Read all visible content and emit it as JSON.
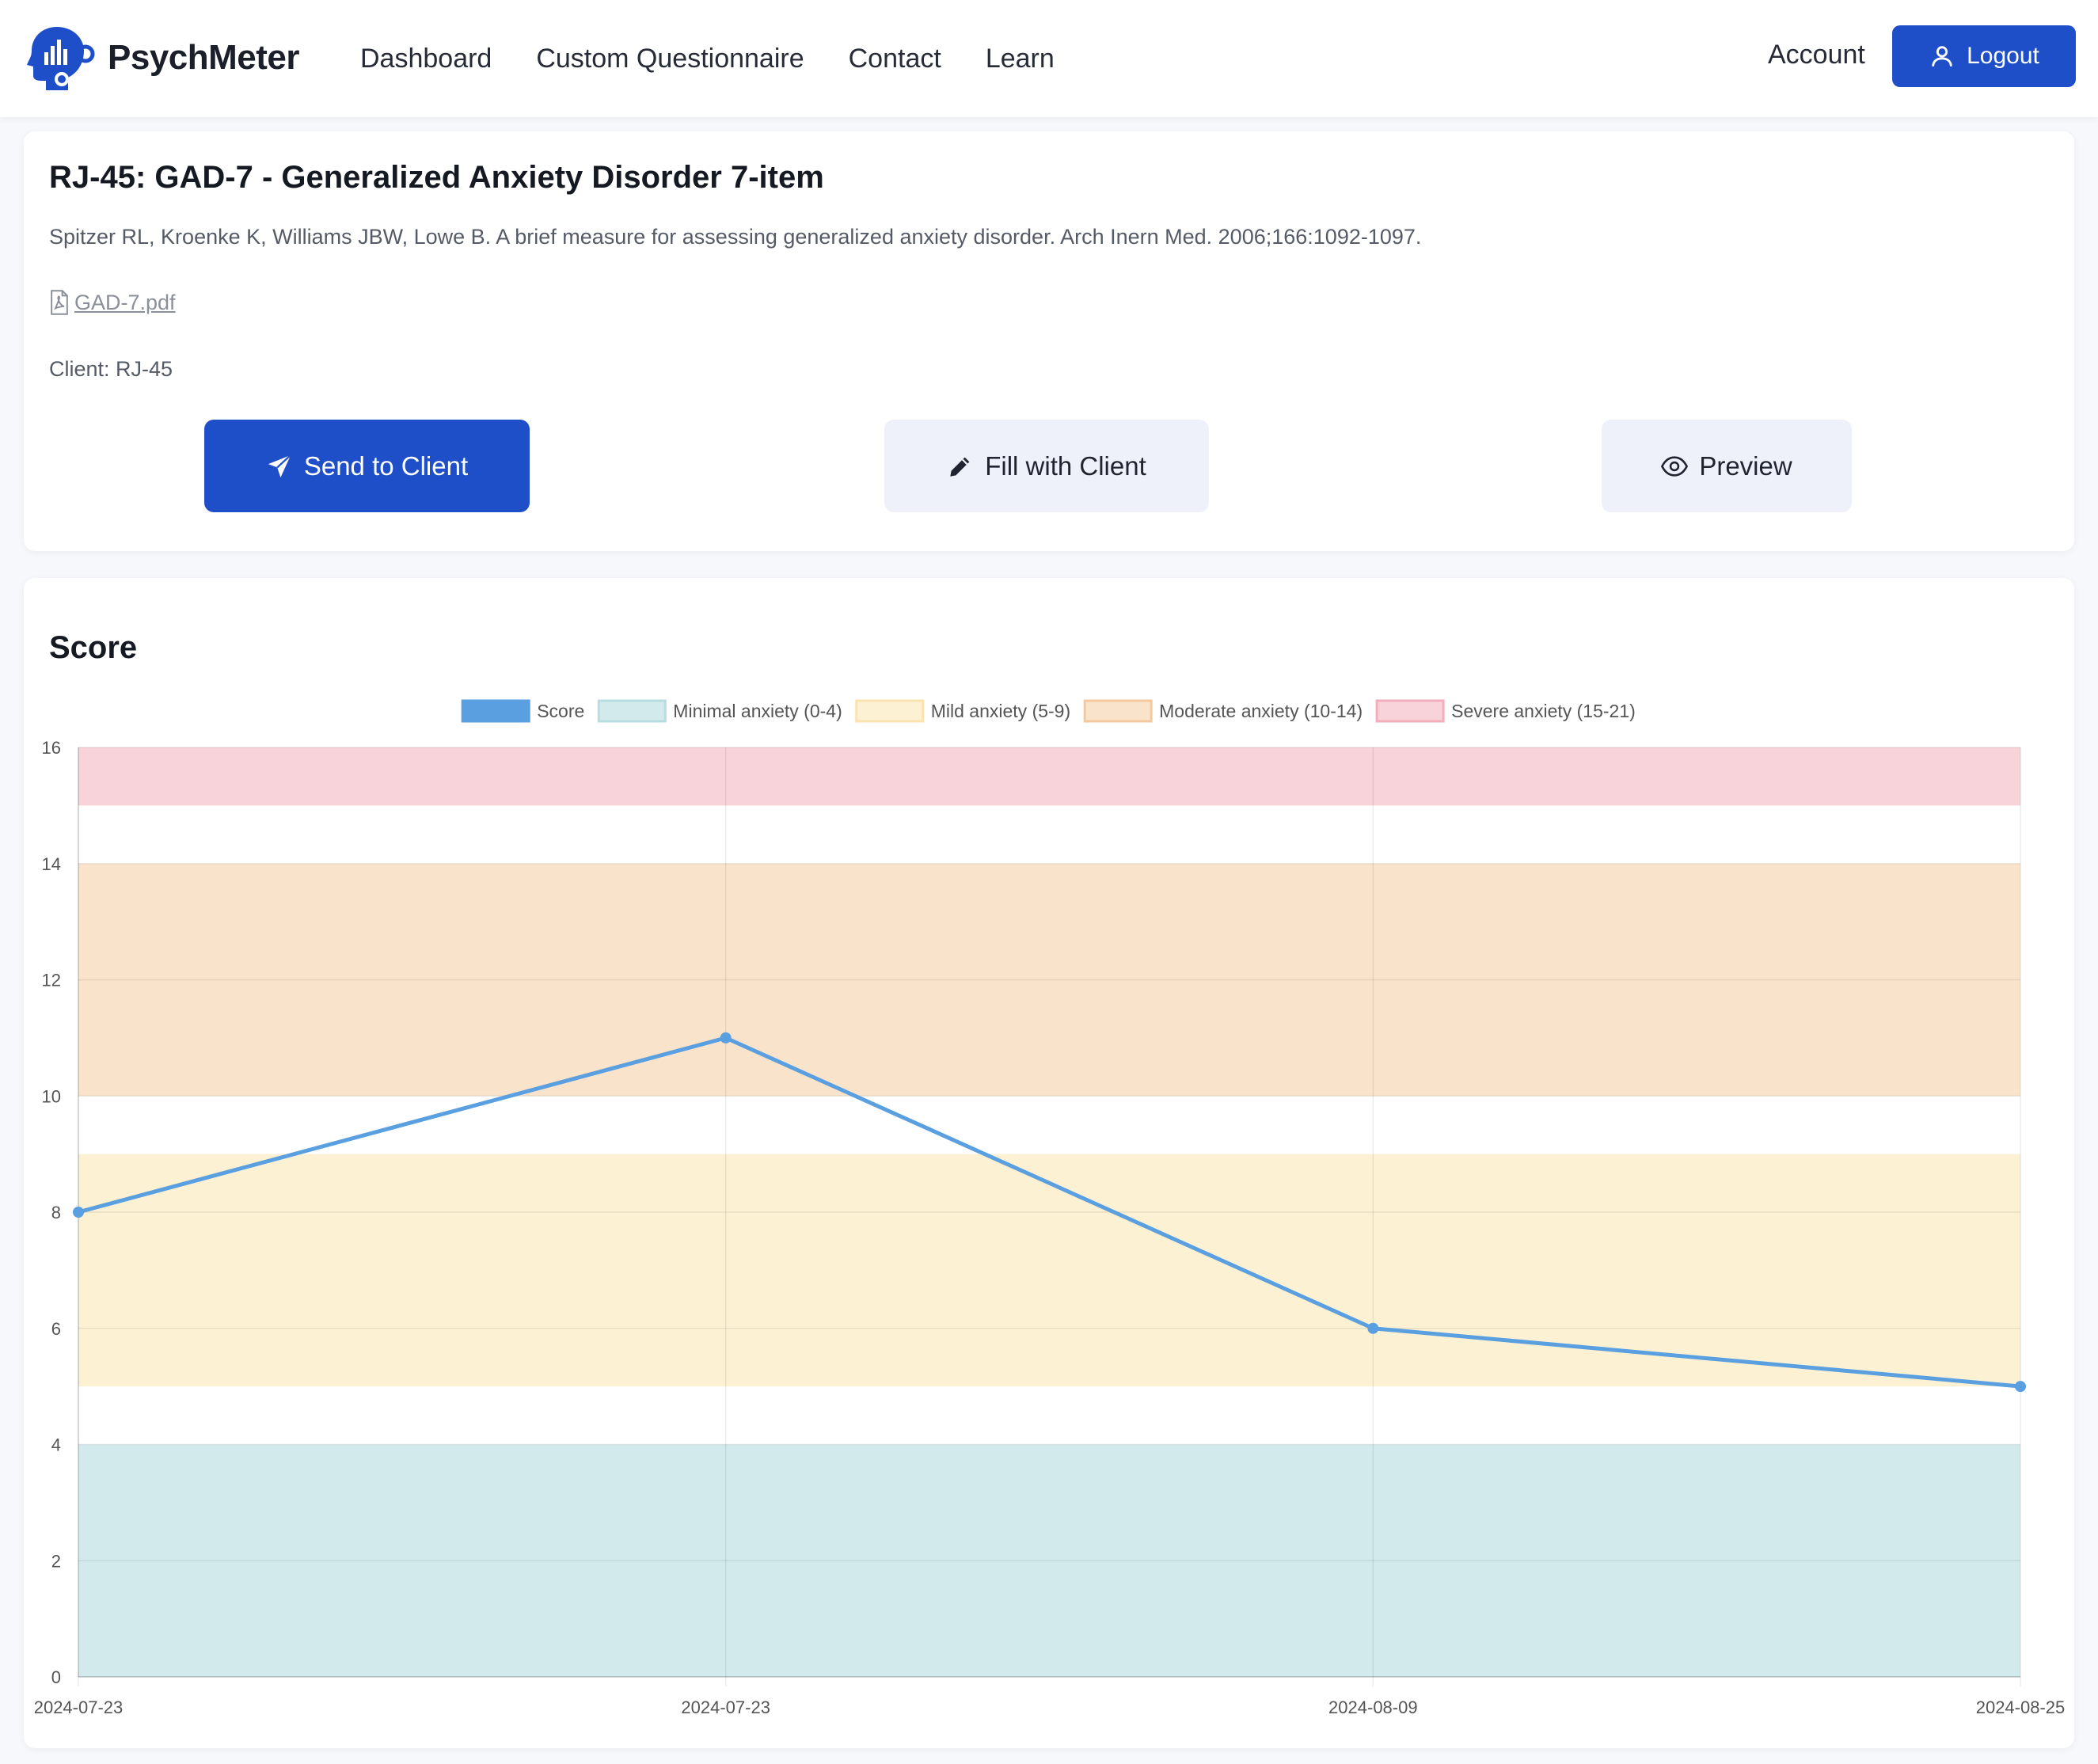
{
  "navbar": {
    "brand": "PsychMeter",
    "links": [
      "Dashboard",
      "Custom Questionnaire",
      "Contact",
      "Learn"
    ],
    "account": "Account",
    "logout": "Logout",
    "colors": {
      "primary": "#1f4fc8"
    }
  },
  "questionnaire": {
    "title": "RJ-45: GAD-7 - Generalized Anxiety Disorder 7-item",
    "reference": "Spitzer RL, Kroenke K, Williams JBW, Lowe B. A brief measure for assessing generalized anxiety disorder. Arch Inern Med. 2006;166:1092-1097.",
    "pdf": "GAD-7.pdf",
    "client": "Client: RJ-45",
    "buttons": {
      "send": "Send to Client",
      "fill": "Fill with Client",
      "preview": "Preview"
    }
  },
  "score_card": {
    "title": "Score"
  },
  "chart_data": {
    "type": "line",
    "x": [
      "2024-07-23",
      "2024-07-23",
      "2024-08-09",
      "2024-08-25"
    ],
    "series": [
      {
        "name": "Score",
        "values": [
          8,
          11,
          6,
          5
        ],
        "color": "#5a9fe0"
      }
    ],
    "bands": [
      {
        "name": "Minimal anxiety (0-4)",
        "from": 0,
        "to": 4,
        "fill": "#d3eaec",
        "stroke": "#b7dde0"
      },
      {
        "name": "Mild anxiety (5-9)",
        "from": 5,
        "to": 9,
        "fill": "#fdf1d3",
        "stroke": "#fbe3b0"
      },
      {
        "name": "Moderate anxiety (10-14)",
        "from": 10,
        "to": 14,
        "fill": "#fae3cb",
        "stroke": "#f5c9a0"
      },
      {
        "name": "Severe anxiety (15-21)",
        "from": 15,
        "to": 21,
        "fill": "#f9d3da",
        "stroke": "#f3aebb"
      }
    ],
    "ylim": [
      0,
      16
    ],
    "yticks": [
      0,
      2,
      4,
      6,
      8,
      10,
      12,
      14,
      16
    ],
    "grid": true,
    "legend": "top-center"
  }
}
